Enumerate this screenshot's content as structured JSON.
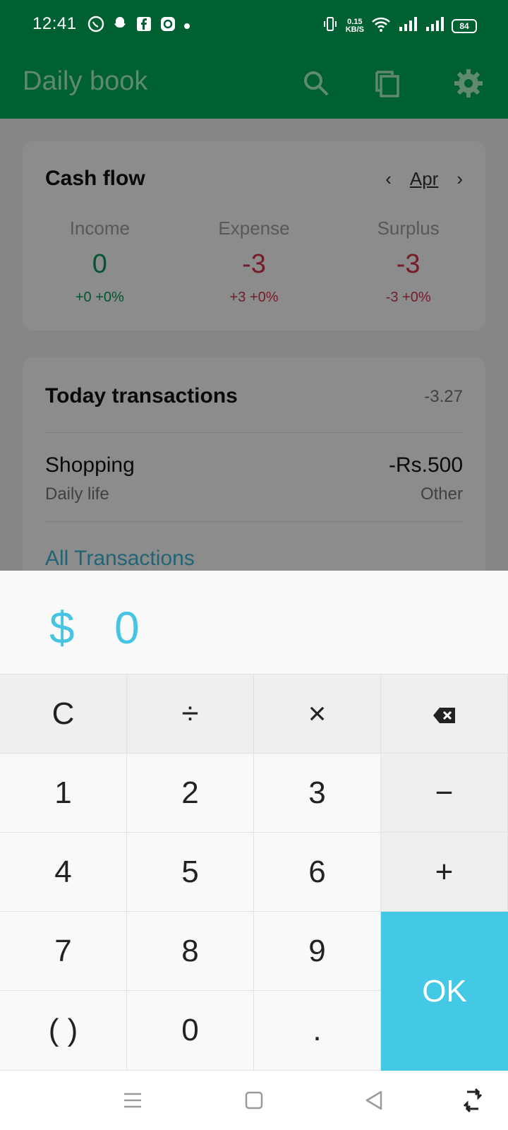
{
  "status_bar": {
    "time": "12:41",
    "notification_icons": [
      "whatsapp-icon",
      "snapchat-icon",
      "facebook-icon",
      "app-icon",
      "dot-icon"
    ],
    "net_speed_value": "0.15",
    "net_speed_unit": "KB/S",
    "battery": "84"
  },
  "app_bar": {
    "title": "Daily book",
    "icons": [
      "search-icon",
      "copy-icon",
      "gear-icon"
    ]
  },
  "cash_flow": {
    "title": "Cash flow",
    "month": "Apr",
    "income": {
      "label": "Income",
      "value": "0",
      "change": "+0  +0%"
    },
    "expense": {
      "label": "Expense",
      "value": "-3",
      "change": "+3  +0%"
    },
    "surplus": {
      "label": "Surplus",
      "value": "-3",
      "change": "-3  +0%"
    },
    "colors": {
      "positive": "#0a9a5a",
      "negative": "#d6334a"
    }
  },
  "today_transactions": {
    "title": "Today transactions",
    "total": "-3.27",
    "items": [
      {
        "title": "Shopping",
        "subtitle": "Daily life",
        "amount": "-Rs.500",
        "category": "Other"
      }
    ],
    "all_link": "All Transactions"
  },
  "calculator": {
    "currency_symbol": "$",
    "amount": "0",
    "keys": {
      "clear": "C",
      "divide": "÷",
      "multiply": "×",
      "one": "1",
      "two": "2",
      "three": "3",
      "minus": "−",
      "four": "4",
      "five": "5",
      "six": "6",
      "plus": "+",
      "seven": "7",
      "eight": "8",
      "nine": "9",
      "ok": "OK",
      "parens": "( )",
      "zero": "0",
      "dot": "."
    },
    "accent": "#43c8e5"
  },
  "nav_bar": {
    "icons": [
      "menu-icon",
      "home-icon",
      "back-icon",
      "rotate-icon"
    ]
  }
}
